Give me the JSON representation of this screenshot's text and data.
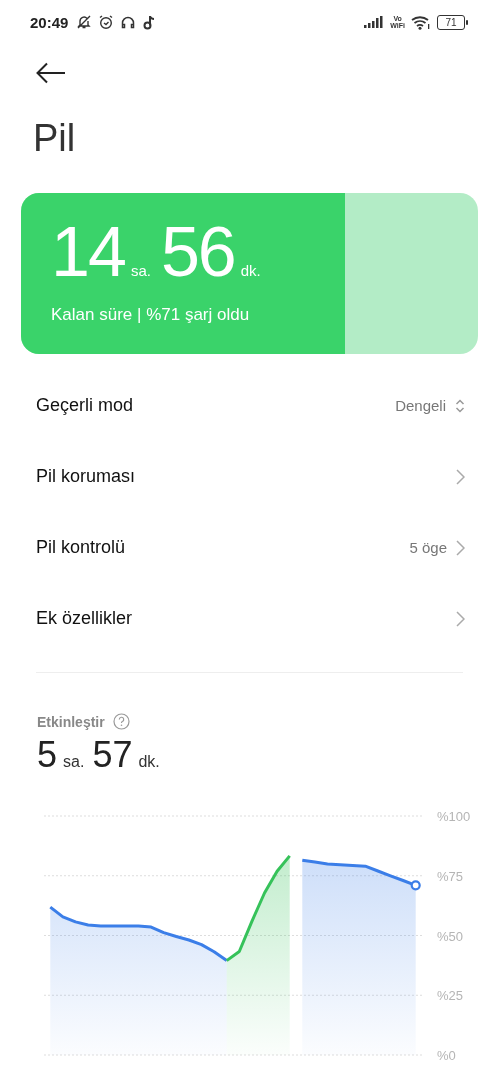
{
  "status_bar": {
    "time": "20:49",
    "wifi_call": [
      "Vo",
      "WiFi"
    ],
    "battery": "71"
  },
  "title": "Pil",
  "battery_card": {
    "hours": "14",
    "hours_unit": "sa.",
    "minutes": "56",
    "minutes_unit": "dk.",
    "caption": "Kalan süre | %71 şarj oldu",
    "level": 0.71
  },
  "settings": [
    {
      "kind": "dropdown",
      "label": "Geçerli mod",
      "value": "Dengeli"
    },
    {
      "kind": "link",
      "label": "Pil koruması"
    },
    {
      "kind": "link",
      "label": "Pil kontrolü",
      "value": "5 öge"
    },
    {
      "kind": "link",
      "label": "Ek özellikler"
    }
  ],
  "usage": {
    "label": "Etkinleştir",
    "hours": "5",
    "hours_unit": "sa.",
    "minutes": "57",
    "minutes_unit": "dk.",
    "chart_data": {
      "type": "area",
      "grid": true,
      "categories": [
        null,
        null,
        null,
        null,
        null,
        null,
        null,
        null,
        null,
        null,
        null,
        null,
        null,
        null,
        null,
        null,
        null,
        null,
        null,
        null,
        null,
        null,
        null,
        null,
        null,
        null,
        null,
        null,
        null,
        null
      ],
      "ylim": [
        0,
        100
      ],
      "yticks": [
        {
          "value": 0,
          "label": "%0"
        },
        {
          "value": 25,
          "label": "%25"
        },
        {
          "value": 50,
          "label": "%50"
        },
        {
          "value": 75,
          "label": "%75"
        },
        {
          "value": 100,
          "label": "%100"
        }
      ],
      "series": [
        {
          "color": "#3b7ee8",
          "values": [
            61.9,
            57.8,
            55.7,
            54.4,
            54,
            54,
            54,
            54,
            53.5,
            51.2,
            49.6,
            48.1,
            46.2,
            43.2,
            39.5,
            null,
            null,
            null,
            null,
            null,
            81.5,
            80.7,
            79.9,
            79.6,
            79.3,
            79,
            77,
            75,
            73,
            71
          ]
        },
        {
          "color": "#36c25a",
          "values": [
            null,
            null,
            null,
            null,
            null,
            null,
            null,
            null,
            null,
            null,
            null,
            null,
            null,
            null,
            39.5,
            43.3,
            55.9,
            67.8,
            76.9,
            83.3,
            null,
            null,
            null,
            null,
            null,
            null,
            null,
            null,
            null,
            null
          ]
        }
      ]
    }
  }
}
